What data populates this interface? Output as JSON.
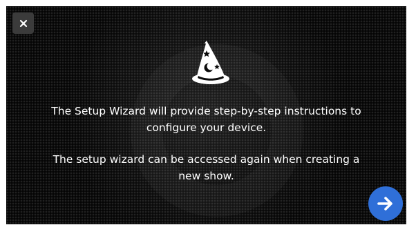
{
  "dialog": {
    "close_icon": "close-icon",
    "hero_icon": "wizard-hat-icon",
    "message_line1": "The Setup Wizard will provide step-by-step instructions to configure your device.",
    "message_line2": "The setup wizard can be accessed again when creating a new show.",
    "next_icon": "arrow-right-icon"
  },
  "colors": {
    "background": "#0b0b0b",
    "close_button_bg": "#3b3b3b",
    "next_button_bg": "#2f6fd8",
    "text": "#ffffff"
  }
}
